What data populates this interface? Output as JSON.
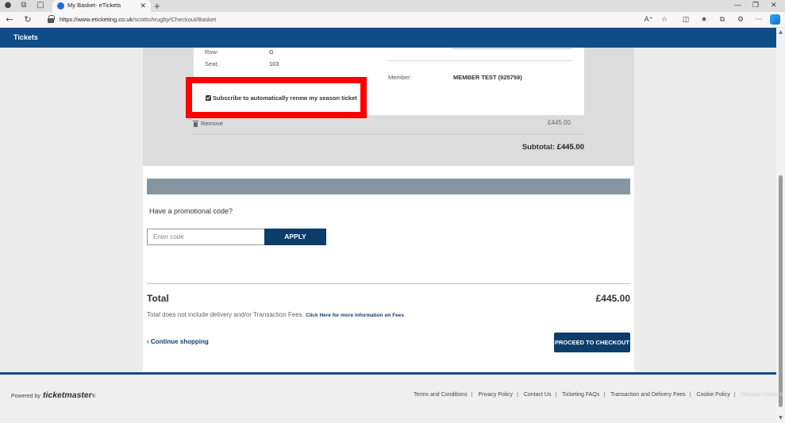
{
  "browser": {
    "tab_title": "My Basket- eTickets",
    "url_host": "https://www.eticketing.co.uk",
    "url_path": "/scottishrugby/Checkout/Basket"
  },
  "site": {
    "title": "Tickets",
    "brand_color": "#0e4d86"
  },
  "ticket": {
    "row_label": "Row:",
    "row_value": "G",
    "seat_label": "Seat:",
    "seat_value": "103",
    "member_label": "Member:",
    "member_value": "MEMBER TEST (925759)",
    "renew_label": "Subscribe to automatically renew my season ticket",
    "renew_checked": true,
    "remove_label": "Remove",
    "price": "£445.00"
  },
  "subtotal": {
    "label": "Subtotal:",
    "value": "£445.00"
  },
  "promo": {
    "question": "Have a promotional code?",
    "placeholder": "Enter code",
    "apply_label": "APPLY"
  },
  "total": {
    "label": "Total",
    "value": "£445.00",
    "note": "Total does not include delivery and/or Transaction Fees.",
    "fees_link": "Click Here for more information on Fees"
  },
  "actions": {
    "continue_label": "Continue shopping",
    "checkout_label": "PROCEED TO CHECKOUT"
  },
  "footer": {
    "powered_by": "Powered by",
    "brand": "ticketmaster",
    "links": [
      "Terms and Conditions",
      "Privacy Policy",
      "Contact Us",
      "Ticketing FAQs",
      "Transaction and Delivery Fees",
      "Cookie Policy",
      "Manage Cookies"
    ]
  },
  "colors": {
    "highlight": "#ff0000",
    "button": "#0d3d6a",
    "promo_bar": "#85969f"
  }
}
